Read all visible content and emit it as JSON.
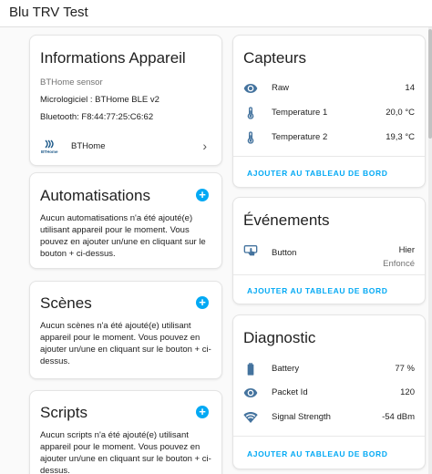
{
  "header": {
    "title": "Blu TRV Test"
  },
  "device_info": {
    "title": "Informations Appareil",
    "model": "BTHome sensor",
    "firmware": "Micrologiciel : BTHome BLE v2",
    "bluetooth": "Bluetooth: F8:44:77:25:C6:62",
    "integration_label": "BTHome",
    "integration_logo_text": "BTHome"
  },
  "automations": {
    "title": "Automatisations",
    "text": "Aucun automatisations n'a été ajouté(e) utilisant appareil pour le moment. Vous pouvez en ajouter un/une en cliquant sur le bouton + ci-dessus."
  },
  "scenes": {
    "title": "Scènes",
    "text": "Aucun scènes n'a été ajouté(e) utilisant appareil pour le moment. Vous pouvez en ajouter un/une en cliquant sur le bouton + ci-dessus."
  },
  "scripts": {
    "title": "Scripts",
    "text": "Aucun scripts n'a été ajouté(e) utilisant appareil pour le moment. Vous pouvez en ajouter un/une en cliquant sur le bouton + ci-dessus."
  },
  "sensors": {
    "title": "Capteurs",
    "rows": [
      {
        "icon": "eye-icon",
        "label": "Raw",
        "value": "14"
      },
      {
        "icon": "thermometer-icon",
        "label": "Temperature 1",
        "value": "20,0 °C"
      },
      {
        "icon": "thermometer-icon",
        "label": "Temperature 2",
        "value": "19,3 °C"
      }
    ],
    "action": "AJOUTER AU TABLEAU DE BORD"
  },
  "events": {
    "title": "Événements",
    "rows": [
      {
        "icon": "gesture-tap-button-icon",
        "label": "Button",
        "value": "Hier",
        "secondary": "Enfoncé"
      }
    ],
    "action": "AJOUTER AU TABLEAU DE BORD"
  },
  "diagnostic": {
    "title": "Diagnostic",
    "rows": [
      {
        "icon": "battery-icon",
        "label": "Battery",
        "value": "77 %"
      },
      {
        "icon": "eye-icon",
        "label": "Packet Id",
        "value": "120"
      },
      {
        "icon": "wifi-icon",
        "label": "Signal Strength",
        "value": "-54 dBm"
      }
    ],
    "action": "AJOUTER AU TABLEAU DE BORD"
  },
  "colors": {
    "accent": "#03a9f4",
    "icon": "#44739e",
    "text": "#212121",
    "muted": "#727272"
  }
}
